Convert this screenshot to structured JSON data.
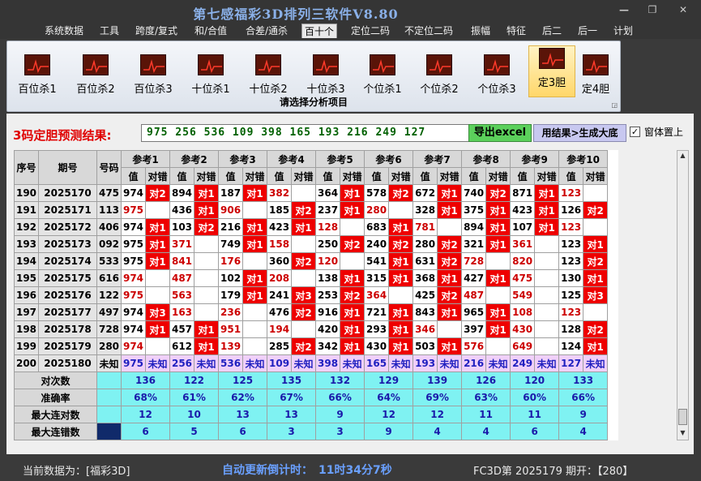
{
  "app": {
    "title": "第七感福彩3D排列三软件V8.80"
  },
  "menu": [
    "系统数据",
    "工具",
    "跨度/复式",
    "和/合值",
    "合差/通杀",
    "百十个",
    "定位二码",
    "不定位二码",
    "振幅",
    "特征",
    "后二",
    "后一",
    "计划"
  ],
  "menu_active": 5,
  "ribbon": {
    "buttons": [
      "百位杀1",
      "百位杀2",
      "百位杀3",
      "十位杀1",
      "十位杀2",
      "十位杀3",
      "个位杀1",
      "个位杀2",
      "个位杀3",
      "定3胆",
      "定4胆"
    ],
    "active": 9,
    "caption": "请选择分析项目"
  },
  "prediction": {
    "label": "3码定胆预测结果:",
    "value": "975 256 536 109 398 165 193 216 249 127",
    "export_btn": "导出excel",
    "gen_btn": "用结果>生成大底",
    "topmost_label": "窗体置上",
    "topmost_checked": true
  },
  "table": {
    "col_seq": "序号",
    "col_period": "期号",
    "col_number": "号码",
    "refs": [
      "参考1",
      "参考2",
      "参考3",
      "参考4",
      "参考5",
      "参考6",
      "参考7",
      "参考8",
      "参考9",
      "参考10"
    ],
    "sub_val": "值",
    "sub_hit": "对错",
    "rows": [
      {
        "seq": "190",
        "period": "2025170",
        "num": "475",
        "cells": [
          [
            "974",
            1,
            "对2"
          ],
          [
            "894",
            1,
            "对1"
          ],
          [
            "187",
            1,
            "对1"
          ],
          [
            "382",
            0,
            ""
          ],
          [
            "364",
            1,
            "对1"
          ],
          [
            "578",
            1,
            "对2"
          ],
          [
            "672",
            1,
            "对1"
          ],
          [
            "740",
            1,
            "对2"
          ],
          [
            "871",
            1,
            "对1"
          ],
          [
            "123",
            0,
            ""
          ]
        ]
      },
      {
        "seq": "191",
        "period": "2025171",
        "num": "113",
        "cells": [
          [
            "975",
            0,
            ""
          ],
          [
            "436",
            1,
            "对1"
          ],
          [
            "906",
            0,
            ""
          ],
          [
            "185",
            1,
            "对2"
          ],
          [
            "237",
            1,
            "对1"
          ],
          [
            "280",
            0,
            ""
          ],
          [
            "328",
            1,
            "对1"
          ],
          [
            "375",
            1,
            "对1"
          ],
          [
            "423",
            1,
            "对1"
          ],
          [
            "126",
            1,
            "对2"
          ]
        ]
      },
      {
        "seq": "192",
        "period": "2025172",
        "num": "406",
        "cells": [
          [
            "974",
            1,
            "对1"
          ],
          [
            "103",
            1,
            "对2"
          ],
          [
            "216",
            1,
            "对1"
          ],
          [
            "423",
            1,
            "对1"
          ],
          [
            "128",
            0,
            ""
          ],
          [
            "683",
            1,
            "对1"
          ],
          [
            "781",
            0,
            ""
          ],
          [
            "894",
            1,
            "对1"
          ],
          [
            "107",
            1,
            "对1"
          ],
          [
            "123",
            0,
            ""
          ]
        ]
      },
      {
        "seq": "193",
        "period": "2025173",
        "num": "092",
        "cells": [
          [
            "975",
            1,
            "对1"
          ],
          [
            "371",
            0,
            ""
          ],
          [
            "749",
            1,
            "对1"
          ],
          [
            "158",
            0,
            ""
          ],
          [
            "250",
            1,
            "对2"
          ],
          [
            "240",
            1,
            "对2"
          ],
          [
            "280",
            1,
            "对2"
          ],
          [
            "321",
            1,
            "对1"
          ],
          [
            "361",
            0,
            ""
          ],
          [
            "123",
            1,
            "对1"
          ]
        ]
      },
      {
        "seq": "194",
        "period": "2025174",
        "num": "533",
        "cells": [
          [
            "975",
            1,
            "对1"
          ],
          [
            "841",
            0,
            ""
          ],
          [
            "176",
            0,
            ""
          ],
          [
            "360",
            1,
            "对2"
          ],
          [
            "120",
            0,
            ""
          ],
          [
            "541",
            1,
            "对1"
          ],
          [
            "631",
            1,
            "对2"
          ],
          [
            "728",
            0,
            ""
          ],
          [
            "820",
            0,
            ""
          ],
          [
            "123",
            1,
            "对2"
          ]
        ]
      },
      {
        "seq": "195",
        "period": "2025175",
        "num": "616",
        "cells": [
          [
            "974",
            0,
            ""
          ],
          [
            "487",
            0,
            ""
          ],
          [
            "102",
            1,
            "对1"
          ],
          [
            "208",
            0,
            ""
          ],
          [
            "138",
            1,
            "对1"
          ],
          [
            "315",
            1,
            "对1"
          ],
          [
            "368",
            1,
            "对1"
          ],
          [
            "427",
            1,
            "对1"
          ],
          [
            "475",
            0,
            ""
          ],
          [
            "130",
            1,
            "对1"
          ]
        ]
      },
      {
        "seq": "196",
        "period": "2025176",
        "num": "122",
        "cells": [
          [
            "975",
            0,
            ""
          ],
          [
            "563",
            0,
            ""
          ],
          [
            "179",
            1,
            "对1"
          ],
          [
            "241",
            1,
            "对3"
          ],
          [
            "253",
            1,
            "对2"
          ],
          [
            "364",
            0,
            ""
          ],
          [
            "425",
            1,
            "对2"
          ],
          [
            "487",
            0,
            ""
          ],
          [
            "549",
            0,
            ""
          ],
          [
            "125",
            1,
            "对3"
          ]
        ]
      },
      {
        "seq": "197",
        "period": "2025177",
        "num": "497",
        "cells": [
          [
            "974",
            1,
            "对3"
          ],
          [
            "163",
            0,
            ""
          ],
          [
            "236",
            0,
            ""
          ],
          [
            "476",
            1,
            "对2"
          ],
          [
            "916",
            1,
            "对1"
          ],
          [
            "721",
            1,
            "对1"
          ],
          [
            "843",
            1,
            "对1"
          ],
          [
            "965",
            1,
            "对1"
          ],
          [
            "108",
            0,
            ""
          ],
          [
            "123",
            0,
            ""
          ]
        ]
      },
      {
        "seq": "198",
        "period": "2025178",
        "num": "728",
        "cells": [
          [
            "974",
            1,
            "对1"
          ],
          [
            "457",
            1,
            "对1"
          ],
          [
            "951",
            0,
            ""
          ],
          [
            "194",
            0,
            ""
          ],
          [
            "420",
            1,
            "对1"
          ],
          [
            "293",
            1,
            "对1"
          ],
          [
            "346",
            0,
            ""
          ],
          [
            "397",
            1,
            "对1"
          ],
          [
            "430",
            0,
            ""
          ],
          [
            "128",
            1,
            "对2"
          ]
        ]
      },
      {
        "seq": "199",
        "period": "2025179",
        "num": "280",
        "cells": [
          [
            "974",
            0,
            ""
          ],
          [
            "612",
            1,
            "对1"
          ],
          [
            "139",
            0,
            ""
          ],
          [
            "285",
            1,
            "对2"
          ],
          [
            "342",
            1,
            "对1"
          ],
          [
            "430",
            1,
            "对1"
          ],
          [
            "503",
            1,
            "对1"
          ],
          [
            "576",
            0,
            ""
          ],
          [
            "649",
            0,
            ""
          ],
          [
            "124",
            1,
            "对1"
          ]
        ]
      }
    ],
    "pending_row": {
      "seq": "200",
      "period": "2025180",
      "num": "未知",
      "cells": [
        "975",
        "256",
        "536",
        "109",
        "398",
        "165",
        "193",
        "216",
        "249",
        "127"
      ],
      "unknown": "未知"
    },
    "stats": [
      {
        "label": "对次数",
        "values": [
          "136",
          "122",
          "125",
          "135",
          "132",
          "129",
          "139",
          "126",
          "120",
          "133"
        ]
      },
      {
        "label": "准确率",
        "values": [
          "68%",
          "61%",
          "62%",
          "67%",
          "66%",
          "64%",
          "69%",
          "63%",
          "60%",
          "66%"
        ]
      },
      {
        "label": "最大连对数",
        "values": [
          "12",
          "10",
          "13",
          "13",
          "9",
          "12",
          "12",
          "11",
          "11",
          "9"
        ]
      },
      {
        "label": "最大连错数",
        "values": [
          "6",
          "5",
          "6",
          "3",
          "3",
          "9",
          "4",
          "4",
          "6",
          "4"
        ]
      }
    ]
  },
  "status": {
    "current_data": "当前数据为：[福彩3D]",
    "countdown": "自动更新倒计时：　11时34分7秒",
    "period_info": "FC3D第 2025179 期开：【280】"
  },
  "colors": {
    "hit": "#ee0000",
    "stat": "#7ff2f2",
    "pending": "#f0d0f8",
    "excel_btn": "#5bd05b"
  }
}
